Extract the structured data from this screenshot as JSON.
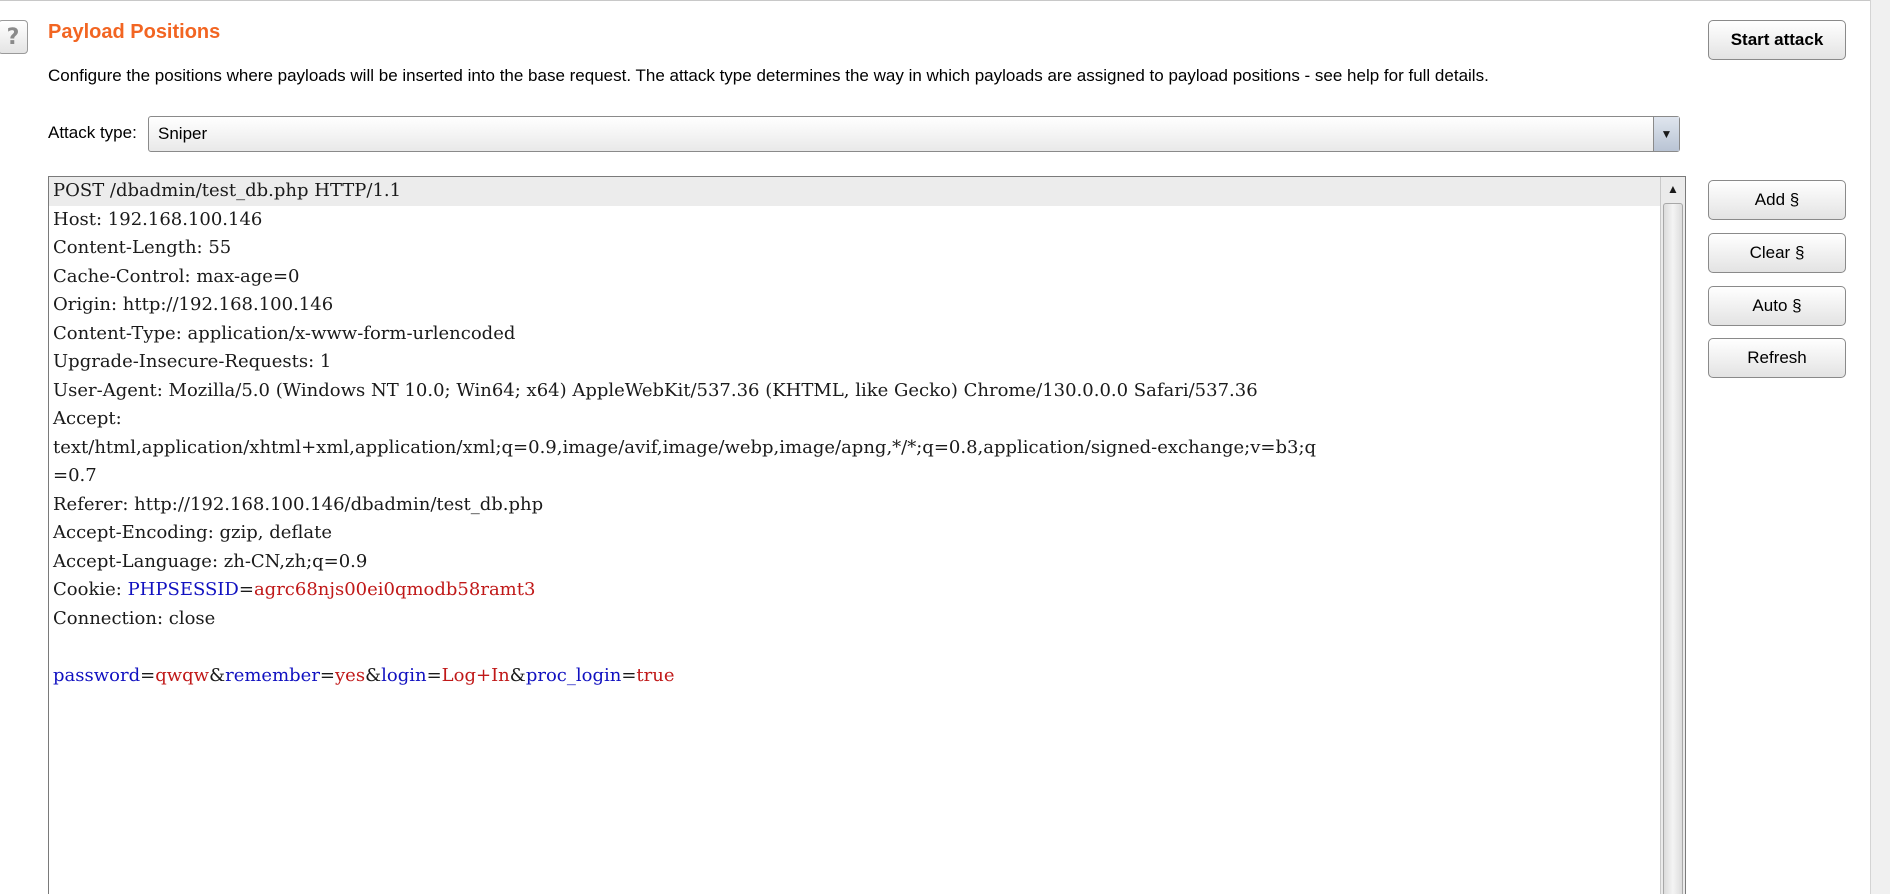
{
  "panel": {
    "title": "Payload Positions",
    "description": "Configure the positions where payloads will be inserted into the base request. The attack type determines the way in which payloads are assigned to payload positions - see help for full details.",
    "help_label": "?"
  },
  "attack": {
    "label": "Attack type:",
    "selected": "Sniper",
    "arrow_icon": "triangle-down"
  },
  "buttons": {
    "start_attack": "Start attack",
    "add": "Add §",
    "clear": "Clear §",
    "auto": "Auto §",
    "refresh": "Refresh"
  },
  "request": {
    "lines": [
      "POST /dbadmin/test_db.php HTTP/1.1",
      "Host: 192.168.100.146",
      "Content-Length: 55",
      "Cache-Control: max-age=0",
      "Origin: http://192.168.100.146",
      "Content-Type: application/x-www-form-urlencoded",
      "Upgrade-Insecure-Requests: 1",
      "User-Agent: Mozilla/5.0 (Windows NT 10.0; Win64; x64) AppleWebKit/537.36 (KHTML, like Gecko) Chrome/130.0.0.0 Safari/537.36",
      "Accept:",
      "text/html,application/xhtml+xml,application/xml;q=0.9,image/avif,image/webp,image/apng,*/*;q=0.8,application/signed-exchange;v=b3;q",
      "=0.7",
      "Referer: http://192.168.100.146/dbadmin/test_db.php",
      "Accept-Encoding: gzip, deflate",
      "Accept-Language: zh-CN,zh;q=0.9"
    ],
    "cookie": {
      "prefix": "Cookie: ",
      "name": "PHPSESSID",
      "value": "agrc68njs00ei0qmodb58ramt3"
    },
    "connection": "Connection: close",
    "body": {
      "p1_name": "password",
      "p1_value": "qwqw",
      "p2_name": "remember",
      "p2_value": "yes",
      "p3_name": "login",
      "p3_value": "Log+In",
      "p4_name": "proc_login",
      "p4_value": "true"
    }
  },
  "colors": {
    "title": "#f26522",
    "param_name": "#1010c0",
    "param_value": "#c01818"
  }
}
